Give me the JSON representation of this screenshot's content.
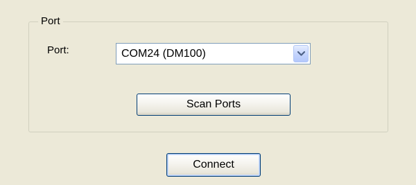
{
  "port_group": {
    "title": "Port",
    "port_label": "Port:",
    "port_select": {
      "selected": "COM24 (DM100)"
    },
    "scan_button": "Scan Ports"
  },
  "footer": {
    "connect_button": "Connect"
  },
  "icons": {
    "dropdown": "chevron-down-icon"
  },
  "colors": {
    "dialog_bg": "#ece9d8",
    "combo_border": "#7f9db9",
    "button_border": "#003c74",
    "arrow_color": "#4d6185"
  }
}
